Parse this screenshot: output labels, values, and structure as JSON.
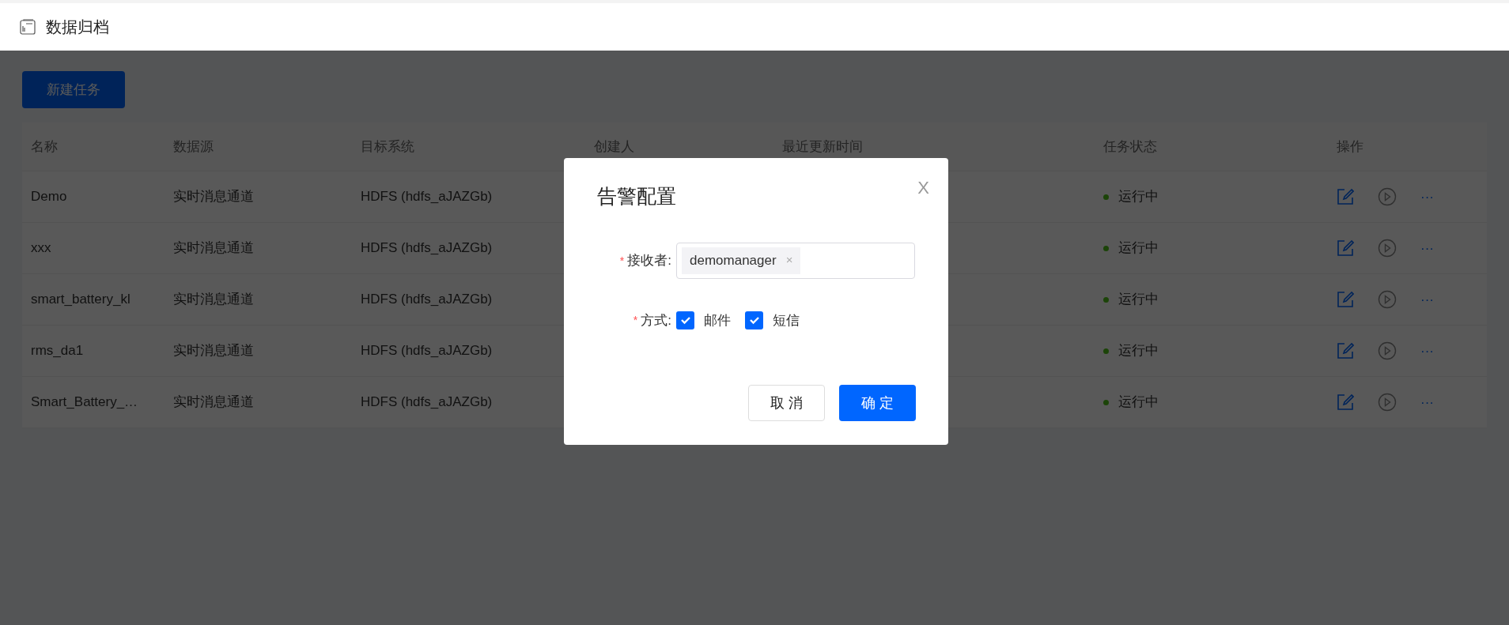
{
  "header": {
    "title": "数据归档"
  },
  "toolbar": {
    "new_button": "新建任务"
  },
  "table": {
    "columns": [
      "名称",
      "数据源",
      "目标系统",
      "创建人",
      "最近更新时间",
      "任务状态",
      "操作"
    ],
    "rows": [
      {
        "name": "Demo",
        "source": "实时消息通道",
        "target": "HDFS (hdfs_aJAZGb)",
        "status": {
          "kind": "running",
          "text": "运行中"
        },
        "more": "···"
      },
      {
        "name": "xxx",
        "source": "实时消息通道",
        "target": "HDFS (hdfs_aJAZGb)",
        "status": {
          "kind": "running",
          "text": "运行中"
        },
        "more": "···"
      },
      {
        "name": "smart_battery_kl",
        "source": "实时消息通道",
        "target": "HDFS (hdfs_aJAZGb)",
        "status": {
          "kind": "running",
          "text": "运行中"
        },
        "more": "···"
      },
      {
        "name": "rms_da1",
        "source": "实时消息通道",
        "target": "HDFS (hdfs_aJAZGb)",
        "status": {
          "kind": "running",
          "text": "运行中"
        },
        "more": "···"
      },
      {
        "name": "Smart_Battery_…",
        "source": "实时消息通道",
        "target": "HDFS (hdfs_aJAZGb)",
        "status": {
          "kind": "running",
          "text": "运行中"
        },
        "more": "···"
      }
    ]
  },
  "dialog": {
    "title": "告警配置",
    "close": "X",
    "receiver": {
      "label": "接收者:",
      "required_mark": "*",
      "tags": [
        {
          "text": "demomanager",
          "remove": "×"
        }
      ]
    },
    "method": {
      "label": "方式:",
      "required_mark": "*",
      "options": [
        {
          "label": "邮件",
          "checked": true
        },
        {
          "label": "短信",
          "checked": true
        }
      ]
    },
    "buttons": {
      "cancel": "取 消",
      "confirm": "确 定"
    }
  }
}
